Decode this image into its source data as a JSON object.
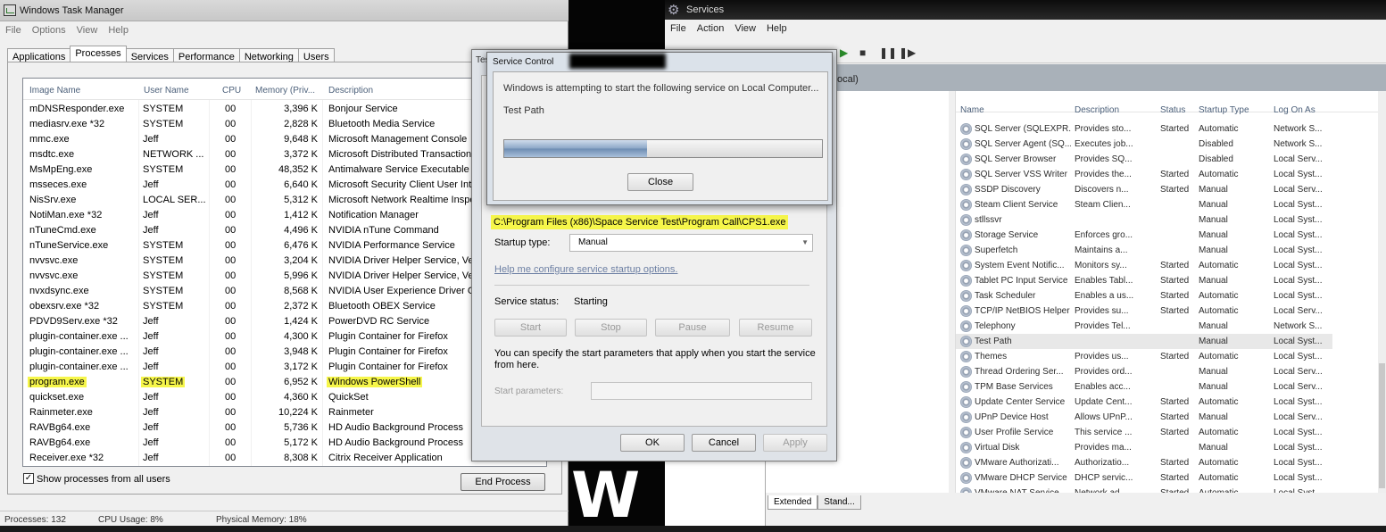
{
  "task_manager": {
    "title": "Windows Task Manager",
    "menu": [
      "File",
      "Options",
      "View",
      "Help"
    ],
    "tabs": [
      "Applications",
      "Processes",
      "Services",
      "Performance",
      "Networking",
      "Users"
    ],
    "active_tab": "Processes",
    "columns": [
      "Image Name",
      "User Name",
      "CPU",
      "Memory (Priv...",
      "Description"
    ],
    "processes": [
      {
        "image": "mDNSResponder.exe",
        "user": "SYSTEM",
        "cpu": "00",
        "mem": "3,396 K",
        "desc": "Bonjour Service"
      },
      {
        "image": "mediasrv.exe *32",
        "user": "SYSTEM",
        "cpu": "00",
        "mem": "2,828 K",
        "desc": "Bluetooth Media Service"
      },
      {
        "image": "mmc.exe",
        "user": "Jeff",
        "cpu": "00",
        "mem": "9,648 K",
        "desc": "Microsoft Management Console"
      },
      {
        "image": "msdtc.exe",
        "user": "NETWORK ...",
        "cpu": "00",
        "mem": "3,372 K",
        "desc": "Microsoft Distributed Transaction"
      },
      {
        "image": "MsMpEng.exe",
        "user": "SYSTEM",
        "cpu": "00",
        "mem": "48,352 K",
        "desc": "Antimalware Service Executable"
      },
      {
        "image": "msseces.exe",
        "user": "Jeff",
        "cpu": "00",
        "mem": "6,640 K",
        "desc": "Microsoft Security Client User Inte"
      },
      {
        "image": "NisSrv.exe",
        "user": "LOCAL SER...",
        "cpu": "00",
        "mem": "5,312 K",
        "desc": "Microsoft Network Realtime Inspe"
      },
      {
        "image": "NotiMan.exe *32",
        "user": "Jeff",
        "cpu": "00",
        "mem": "1,412 K",
        "desc": "Notification Manager"
      },
      {
        "image": "nTuneCmd.exe",
        "user": "Jeff",
        "cpu": "00",
        "mem": "4,496 K",
        "desc": "NVIDIA nTune Command"
      },
      {
        "image": "nTuneService.exe",
        "user": "SYSTEM",
        "cpu": "00",
        "mem": "6,476 K",
        "desc": "NVIDIA Performance Service"
      },
      {
        "image": "nvvsvc.exe",
        "user": "SYSTEM",
        "cpu": "00",
        "mem": "3,204 K",
        "desc": "NVIDIA Driver Helper Service, Ver"
      },
      {
        "image": "nvvsvc.exe",
        "user": "SYSTEM",
        "cpu": "00",
        "mem": "5,996 K",
        "desc": "NVIDIA Driver Helper Service, Ver"
      },
      {
        "image": "nvxdsync.exe",
        "user": "SYSTEM",
        "cpu": "00",
        "mem": "8,568 K",
        "desc": "NVIDIA User Experience Driver C"
      },
      {
        "image": "obexsrv.exe *32",
        "user": "SYSTEM",
        "cpu": "00",
        "mem": "2,372 K",
        "desc": "Bluetooth OBEX Service"
      },
      {
        "image": "PDVD9Serv.exe *32",
        "user": "Jeff",
        "cpu": "00",
        "mem": "1,424 K",
        "desc": "PowerDVD RC Service"
      },
      {
        "image": "plugin-container.exe ...",
        "user": "Jeff",
        "cpu": "00",
        "mem": "4,300 K",
        "desc": "Plugin Container for Firefox"
      },
      {
        "image": "plugin-container.exe ...",
        "user": "Jeff",
        "cpu": "00",
        "mem": "3,948 K",
        "desc": "Plugin Container for Firefox"
      },
      {
        "image": "plugin-container.exe ...",
        "user": "Jeff",
        "cpu": "00",
        "mem": "3,172 K",
        "desc": "Plugin Container for Firefox"
      },
      {
        "image": "program.exe",
        "user": "SYSTEM",
        "cpu": "00",
        "mem": "6,952 K",
        "desc": "Windows PowerShell",
        "highlight": true
      },
      {
        "image": "quickset.exe",
        "user": "Jeff",
        "cpu": "00",
        "mem": "4,360 K",
        "desc": "QuickSet"
      },
      {
        "image": "Rainmeter.exe",
        "user": "Jeff",
        "cpu": "00",
        "mem": "10,224 K",
        "desc": "Rainmeter"
      },
      {
        "image": "RAVBg64.exe",
        "user": "Jeff",
        "cpu": "00",
        "mem": "5,736 K",
        "desc": "HD Audio Background Process"
      },
      {
        "image": "RAVBg64.exe",
        "user": "Jeff",
        "cpu": "00",
        "mem": "5,172 K",
        "desc": "HD Audio Background Process"
      },
      {
        "image": "Receiver.exe *32",
        "user": "Jeff",
        "cpu": "00",
        "mem": "8,308 K",
        "desc": "Citrix Receiver Application"
      }
    ],
    "show_all_label": "Show processes from all users",
    "show_all_check": "✓",
    "end_process_label": "End Process",
    "status": {
      "processes": "Processes: 132",
      "cpu": "CPU Usage: 8%",
      "memory": "Physical Memory: 18%"
    }
  },
  "background_glyph": "W",
  "services": {
    "title": "Services",
    "menu": [
      "File",
      "Action",
      "View",
      "Help"
    ],
    "header_label": "ocal)",
    "columns": [
      "Name",
      "Description",
      "Status",
      "Startup Type",
      "Log On As"
    ],
    "rows": [
      {
        "name": "SQL Server (SQLEXPR...",
        "desc": "Provides sto...",
        "status": "Started",
        "startup": "Automatic",
        "logon": "Network S..."
      },
      {
        "name": "SQL Server Agent (SQ...",
        "desc": "Executes job...",
        "status": "",
        "startup": "Disabled",
        "logon": "Network S..."
      },
      {
        "name": "SQL Server Browser",
        "desc": "Provides SQ...",
        "status": "",
        "startup": "Disabled",
        "logon": "Local Serv..."
      },
      {
        "name": "SQL Server VSS Writer",
        "desc": "Provides the...",
        "status": "Started",
        "startup": "Automatic",
        "logon": "Local Syst..."
      },
      {
        "name": "SSDP Discovery",
        "desc": "Discovers n...",
        "status": "Started",
        "startup": "Manual",
        "logon": "Local Serv..."
      },
      {
        "name": "Steam Client Service",
        "desc": "Steam Clien...",
        "status": "",
        "startup": "Manual",
        "logon": "Local Syst..."
      },
      {
        "name": "stllssvr",
        "desc": "",
        "status": "",
        "startup": "Manual",
        "logon": "Local Syst..."
      },
      {
        "name": "Storage Service",
        "desc": "Enforces gro...",
        "status": "",
        "startup": "Manual",
        "logon": "Local Syst..."
      },
      {
        "name": "Superfetch",
        "desc": "Maintains a...",
        "status": "",
        "startup": "Manual",
        "logon": "Local Syst..."
      },
      {
        "name": "System Event Notific...",
        "desc": "Monitors sy...",
        "status": "Started",
        "startup": "Automatic",
        "logon": "Local Syst..."
      },
      {
        "name": "Tablet PC Input Service",
        "desc": "Enables Tabl...",
        "status": "Started",
        "startup": "Manual",
        "logon": "Local Syst..."
      },
      {
        "name": "Task Scheduler",
        "desc": "Enables a us...",
        "status": "Started",
        "startup": "Automatic",
        "logon": "Local Syst..."
      },
      {
        "name": "TCP/IP NetBIOS Helper",
        "desc": "Provides su...",
        "status": "Started",
        "startup": "Automatic",
        "logon": "Local Serv..."
      },
      {
        "name": "Telephony",
        "desc": "Provides Tel...",
        "status": "",
        "startup": "Manual",
        "logon": "Network S..."
      },
      {
        "name": "Test Path",
        "desc": "",
        "status": "",
        "startup": "Manual",
        "logon": "Local Syst...",
        "selected": true
      },
      {
        "name": "Themes",
        "desc": "Provides us...",
        "status": "Started",
        "startup": "Automatic",
        "logon": "Local Syst..."
      },
      {
        "name": "Thread Ordering Ser...",
        "desc": "Provides ord...",
        "status": "",
        "startup": "Manual",
        "logon": "Local Serv..."
      },
      {
        "name": "TPM Base Services",
        "desc": "Enables acc...",
        "status": "",
        "startup": "Manual",
        "logon": "Local Serv..."
      },
      {
        "name": "Update Center Service",
        "desc": "Update Cent...",
        "status": "Started",
        "startup": "Automatic",
        "logon": "Local Syst..."
      },
      {
        "name": "UPnP Device Host",
        "desc": "Allows UPnP...",
        "status": "Started",
        "startup": "Manual",
        "logon": "Local Serv..."
      },
      {
        "name": "User Profile Service",
        "desc": "This service ...",
        "status": "Started",
        "startup": "Automatic",
        "logon": "Local Syst..."
      },
      {
        "name": "Virtual Disk",
        "desc": "Provides ma...",
        "status": "",
        "startup": "Manual",
        "logon": "Local Syst..."
      },
      {
        "name": "VMware Authorizati...",
        "desc": "Authorizatio...",
        "status": "Started",
        "startup": "Automatic",
        "logon": "Local Syst..."
      },
      {
        "name": "VMware DHCP Service",
        "desc": "DHCP servic...",
        "status": "Started",
        "startup": "Automatic",
        "logon": "Local Syst..."
      },
      {
        "name": "VMware NAT Service",
        "desc": "Network ad...",
        "status": "Started",
        "startup": "Automatic",
        "logon": "Local Syst..."
      }
    ],
    "bottom_tabs": [
      "Extended",
      "Stand..."
    ]
  },
  "properties_dialog": {
    "title_fragment": "Tes",
    "path": "C:\\Program Files (x86)\\Space Service Test\\Program Call\\CPS1.exe",
    "startup_type_label": "Startup type:",
    "startup_type_value": "Manual",
    "help_link": "Help me configure service startup options.",
    "status_label": "Service status:",
    "status_value": "Starting",
    "start": "Start",
    "stop": "Stop",
    "pause": "Pause",
    "resume": "Resume",
    "param_text": "You can specify the start parameters that apply when you start the service from here.",
    "param_label": "Start parameters:",
    "ok": "OK",
    "cancel": "Cancel",
    "apply": "Apply"
  },
  "service_control": {
    "title": "Service Control",
    "message": "Windows is attempting to start the following service on Local Computer...",
    "service_name": "Test Path",
    "progress": 0.45,
    "close": "Close"
  },
  "colors": {
    "highlight": "#f6f64a",
    "progress_fill": "#7b9ac0"
  }
}
